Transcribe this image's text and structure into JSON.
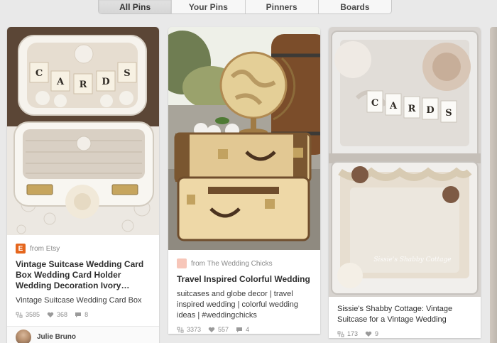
{
  "tabs": [
    {
      "label": "All Pins",
      "active": true
    },
    {
      "label": "Your Pins",
      "active": false
    },
    {
      "label": "Pinners",
      "active": false
    },
    {
      "label": "Boards",
      "active": false
    }
  ],
  "pins": [
    {
      "source_icon": "etsy-icon",
      "source_icon_letter": "E",
      "source_icon_color": "#e5661d",
      "source": "from Etsy",
      "title": "Vintage Suitcase Wedding Card Box Wedding Card Holder Wedding Decoration Ivory…",
      "description": "Vintage Suitcase Wedding Card Box",
      "repins": "3585",
      "likes": "368",
      "comments": "8",
      "pinner": "Julie Bruno",
      "image_letters": [
        "C",
        "A",
        "R",
        "D",
        "S"
      ]
    },
    {
      "source_icon": "wedding-chicks-icon",
      "source_icon_color": "#f7c6b9",
      "source": "from The Wedding Chicks",
      "title": "Travel Inspired Colorful Wedding",
      "description": "suitcases and globe decor | travel inspired wedding | colorful wedding ideas | #weddingchicks",
      "repins": "3373",
      "likes": "557",
      "comments": "4"
    },
    {
      "title": "Sissie's Shabby Cottage: Vintage Suitcase for a Vintage Wedding",
      "repins": "173",
      "likes": "9",
      "watermark": "Sissie's Shabby Cottage",
      "image_letters": [
        "C",
        "A",
        "R",
        "D",
        "S"
      ]
    }
  ],
  "colors": {
    "page_bg": "#e9e9e9",
    "card_bg": "#ffffff",
    "meta_text": "#8c8c8c"
  }
}
